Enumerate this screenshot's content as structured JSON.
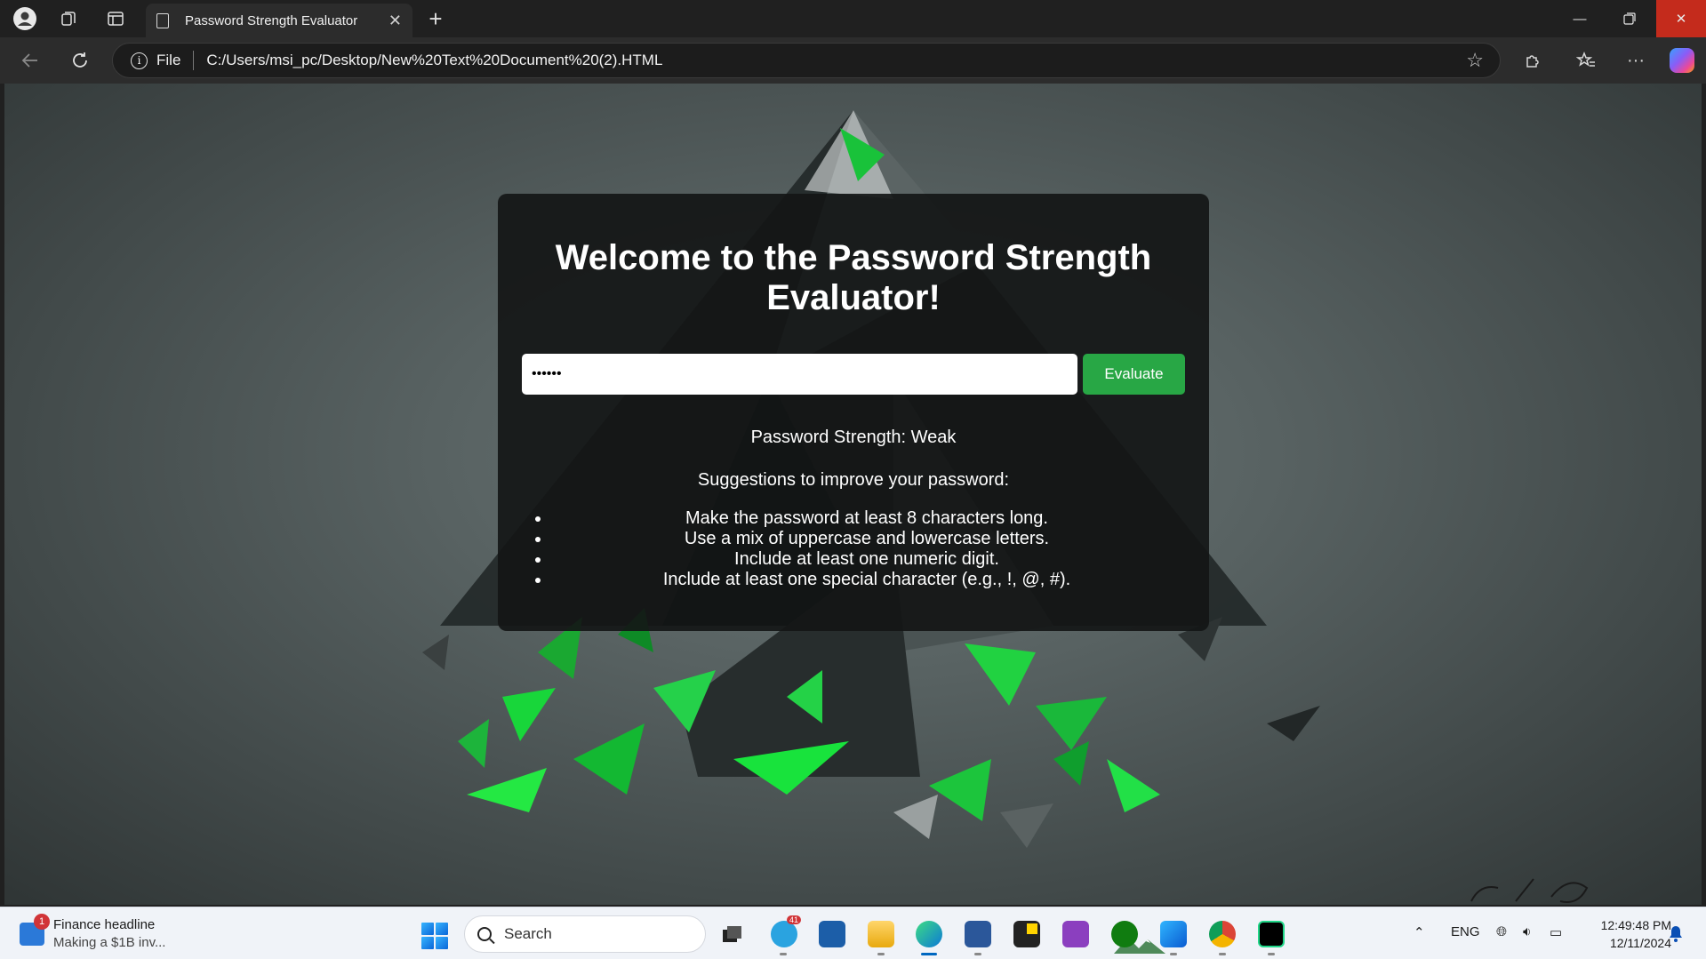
{
  "browser": {
    "tab_title": "Password Strength Evaluator",
    "address_scheme": "File",
    "address_url": "C:/Users/msi_pc/Desktop/New%20Text%20Document%20(2).HTML"
  },
  "page": {
    "heading": "Welcome to the Password Strength Evaluator!",
    "password_value": "••••••",
    "evaluate_label": "Evaluate",
    "strength_text": "Password Strength: Weak",
    "suggestions_title": "Suggestions to improve your password:",
    "suggestions": [
      "Make the password at least 8 characters long.",
      "Use a mix of uppercase and lowercase letters.",
      "Include at least one numeric digit.",
      "Include at least one special character (e.g., !, @, #)."
    ],
    "accent_color": "#28a745"
  },
  "taskbar": {
    "news_title": "Finance headline",
    "news_subtitle": "Making a $1B inv...",
    "news_badge": "1",
    "search_placeholder": "Search",
    "telegram_badge": "41",
    "language": "ENG",
    "time": "12:49:48 PM",
    "date": "12/11/2024"
  }
}
